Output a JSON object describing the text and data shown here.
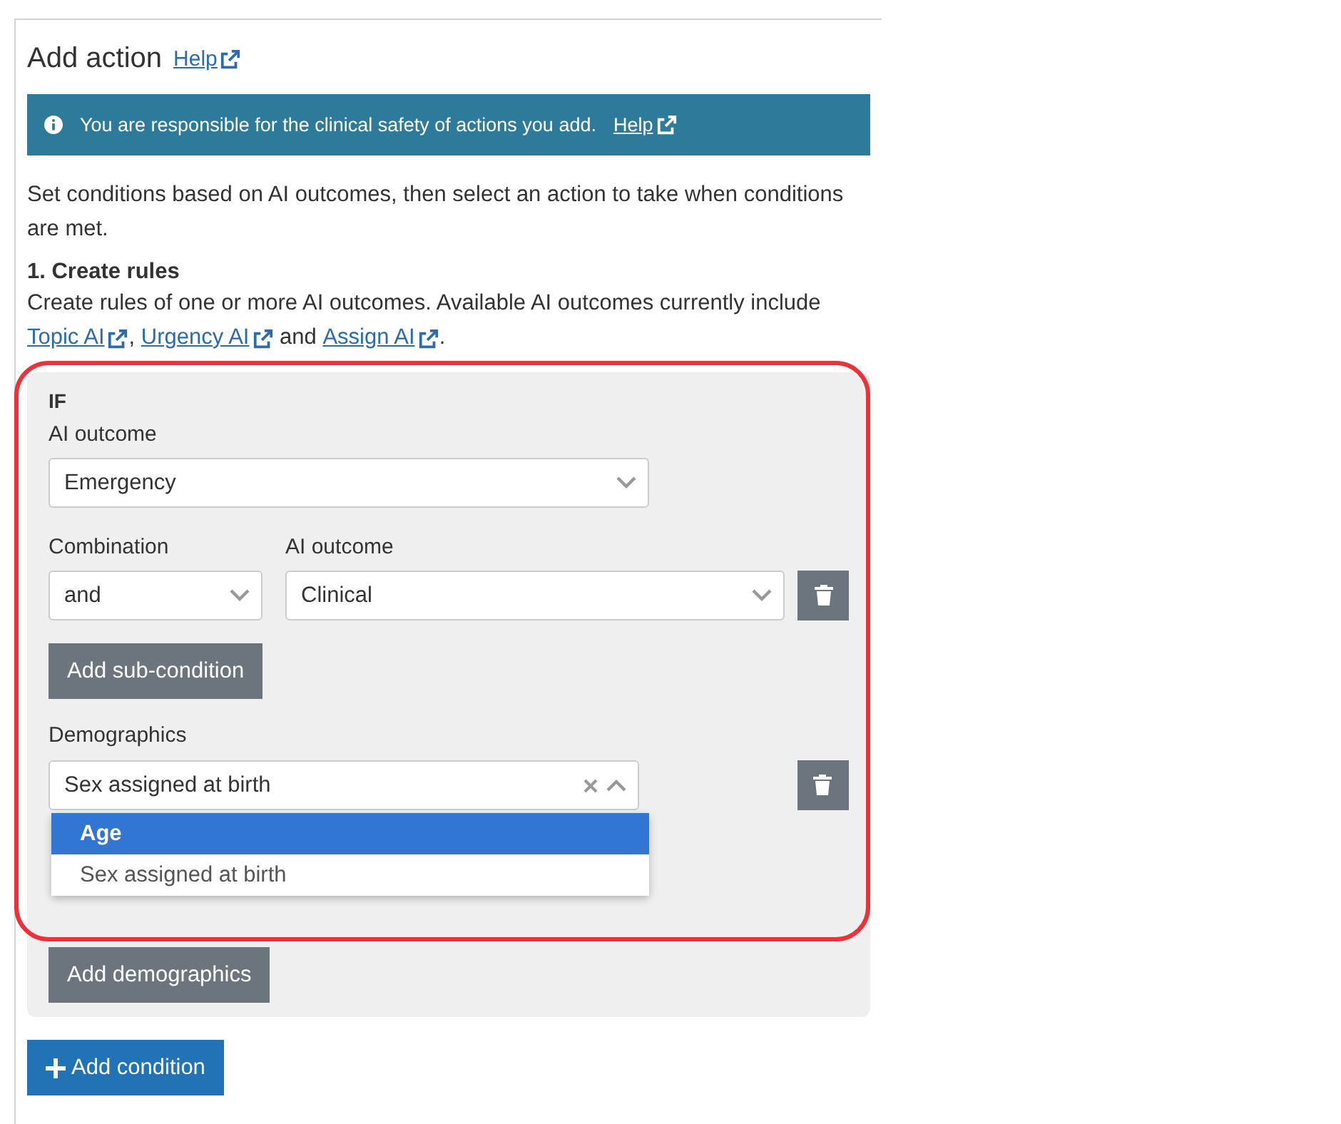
{
  "header": {
    "title": "Add action",
    "help_link": "Help"
  },
  "banner": {
    "text": "You are responsible for the clinical safety of actions you add.",
    "help_link": "Help"
  },
  "intro": "Set conditions based on AI outcomes, then select an action to take when conditions are met.",
  "section": {
    "heading": "1. Create rules",
    "text_before": "Create rules of one or more AI outcomes. Available AI outcomes currently include ",
    "links": [
      {
        "label": "Topic AI",
        "after": ", "
      },
      {
        "label": "Urgency AI",
        "after": " and "
      },
      {
        "label": "Assign AI",
        "after": "."
      }
    ]
  },
  "condition": {
    "title": "IF",
    "outcome_label": "AI outcome",
    "outcome_value": "Emergency",
    "sub_conditions": [
      {
        "combination_label": "Combination",
        "combination_value": "and",
        "outcome_label": "AI outcome",
        "outcome_value": "Clinical"
      }
    ],
    "sub_condition_button": "Add sub-condition",
    "demographics_label": "Demographics",
    "demographics_value": "Sex assigned at birth",
    "demographics_open": true,
    "demographics_options": [
      {
        "label": "Age",
        "selected": true
      },
      {
        "label": "Sex assigned at birth",
        "selected": false
      }
    ],
    "demographics_button": "Add demographics"
  },
  "highlighted": true,
  "add_condition_button": "Add condition"
}
